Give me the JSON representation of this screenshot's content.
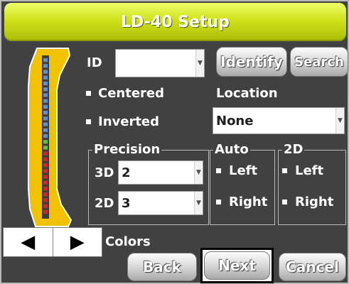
{
  "window": {
    "title": "LD-40 Setup"
  },
  "device": {
    "led_colors": [
      "#5b8fd6",
      "#5b8fd6",
      "#5b8fd6",
      "#5b8fd6",
      "#5b8fd6",
      "#5b8fd6",
      "#5b8fd6",
      "#5b8fd6",
      "#5b8fd6",
      "#5b8fd6",
      "#5b8fd6",
      "#5b8fd6",
      "#5b8fd6",
      "#5b8fd6",
      "#5cc44a",
      "#5cc44a",
      "#cc2a2a",
      "#cc2a2a",
      "#cc2a2a",
      "#cc2a2a",
      "#cc2a2a",
      "#cc2a2a",
      "#cc2a2a",
      "#cc2a2a",
      "#cc2a2a",
      "#cc2a2a",
      "#cc2a2a"
    ],
    "body_color": "#f2c200"
  },
  "id_field": {
    "label": "ID",
    "value": ""
  },
  "buttons": {
    "identify": "Identify",
    "search": "Search",
    "back": "Back",
    "next": "Next",
    "cancel": "Cancel"
  },
  "options": {
    "centered": "Centered",
    "inverted": "Inverted"
  },
  "location": {
    "label": "Location",
    "value": "None"
  },
  "precision": {
    "legend": "Precision",
    "row_3d": {
      "label": "3D",
      "value": "2"
    },
    "row_2d": {
      "label": "2D",
      "value": "3"
    }
  },
  "auto": {
    "legend": "Auto",
    "left": "Left",
    "right": "Right"
  },
  "two_d": {
    "legend": "2D",
    "left": "Left",
    "right": "Right"
  },
  "colors_label": "Colors",
  "nav": {
    "prev": "◀",
    "next": "▶"
  }
}
